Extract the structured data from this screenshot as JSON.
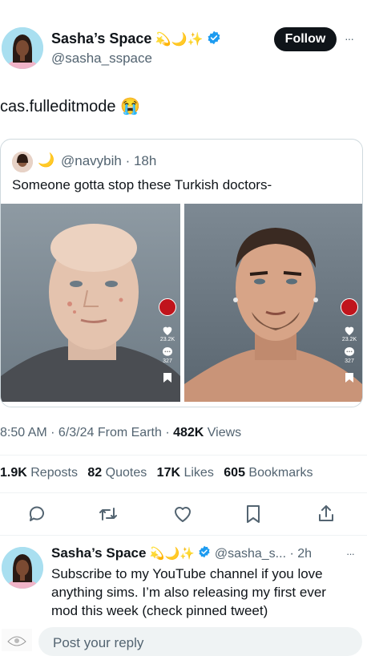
{
  "post": {
    "author_name": "Sasha’s Space",
    "name_emojis": "💫🌙✨",
    "handle": "@sasha_sspace",
    "follow_label": "Follow",
    "more_label": "···",
    "text": "cas.fulleditmode",
    "text_emoji": "😭",
    "timestamp": "8:50 AM · 6/3/24 From Earth · ",
    "views_count": "482K",
    "views_label": " Views"
  },
  "quote": {
    "avatar_emoji": "🌙",
    "handle": "@navybih",
    "time": "· 18h",
    "text": "Someone gotta stop these Turkish doctors-",
    "left_likes": "23.2K",
    "left_comments": "327",
    "right_likes": "23.2K",
    "right_comments": "327"
  },
  "stats": [
    {
      "count": "1.9K",
      "label": " Reposts"
    },
    {
      "count": "82",
      "label": " Quotes"
    },
    {
      "count": "17K",
      "label": " Likes"
    },
    {
      "count": "605",
      "label": " Bookmarks"
    }
  ],
  "reply": {
    "author_name": "Sasha’s Space",
    "name_emojis": "💫🌙✨",
    "handle": "@sasha_s...",
    "time": "· 2h",
    "more_label": "···",
    "text": "Subscribe to my YouTube channel if you love anything sims. I’m also releasing my first ever mod this week (check pinned tweet)"
  },
  "composer": {
    "placeholder": "Post your reply"
  },
  "colors": {
    "verified": "#1d9bf0",
    "text": "#0f1419",
    "muted": "#536471",
    "divider": "#eff3f4"
  }
}
